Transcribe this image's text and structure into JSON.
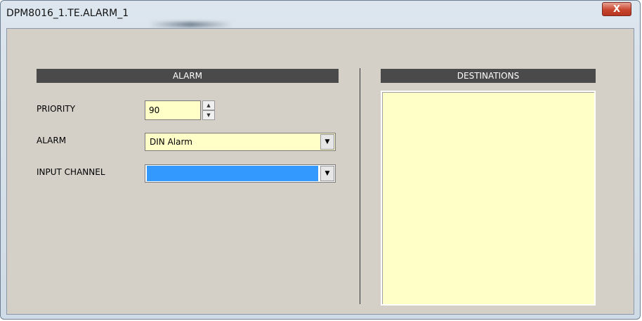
{
  "window": {
    "title": "DPM8016_1.TE.ALARM_1",
    "close_label": "X"
  },
  "alarm_section": {
    "header": "ALARM",
    "priority_label": "PRIORITY",
    "priority_value": "90",
    "alarm_label": "ALARM",
    "alarm_value": "DIN Alarm",
    "input_channel_label": "INPUT CHANNEL",
    "input_channel_value": ""
  },
  "destinations_section": {
    "header": "DESTINATIONS",
    "items": []
  },
  "colors": {
    "field_bg": "#ffffc8",
    "selected": "#3399ff",
    "header_bg": "#4a4a4a",
    "panel_bg": "#d4d0c8"
  }
}
